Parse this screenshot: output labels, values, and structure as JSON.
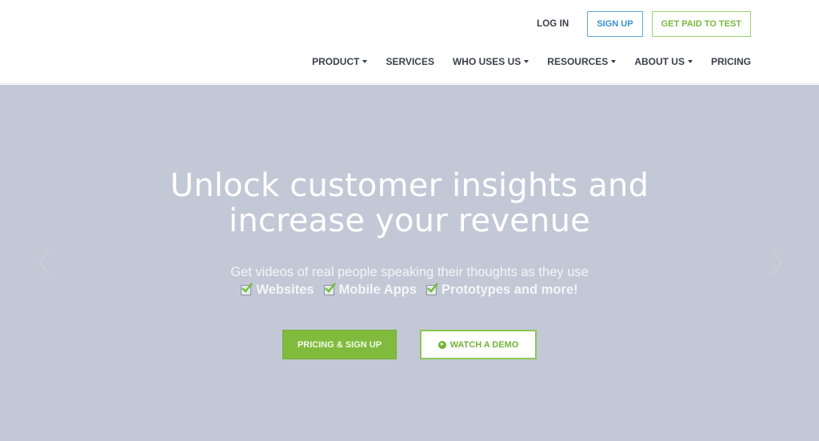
{
  "header": {
    "top_actions": {
      "login": "LOG IN",
      "signup": "SIGN UP",
      "get_paid": "GET PAID TO TEST"
    },
    "nav": [
      {
        "label": "PRODUCT",
        "has_dropdown": true
      },
      {
        "label": "SERVICES",
        "has_dropdown": false
      },
      {
        "label": "WHO USES US",
        "has_dropdown": true
      },
      {
        "label": "RESOURCES",
        "has_dropdown": true
      },
      {
        "label": "ABOUT US",
        "has_dropdown": true
      },
      {
        "label": "PRICING",
        "has_dropdown": false
      }
    ]
  },
  "hero": {
    "title_line1": "Unlock customer insights and",
    "title_line2": "increase your revenue",
    "subtitle": "Get videos of real people speaking their thoughts as they use",
    "features": [
      "Websites",
      "Mobile Apps",
      "Prototypes and more!"
    ],
    "cta_primary": "PRICING & SIGN UP",
    "cta_secondary": "WATCH A DEMO",
    "carousel_prev_icon": "chevron-left-icon",
    "carousel_next_icon": "chevron-right-icon"
  },
  "colors": {
    "hero_background": "#c2c8d6",
    "accent_green": "#80bb3e",
    "accent_blue": "#3b8fd1",
    "nav_text": "#3a3f4a"
  }
}
